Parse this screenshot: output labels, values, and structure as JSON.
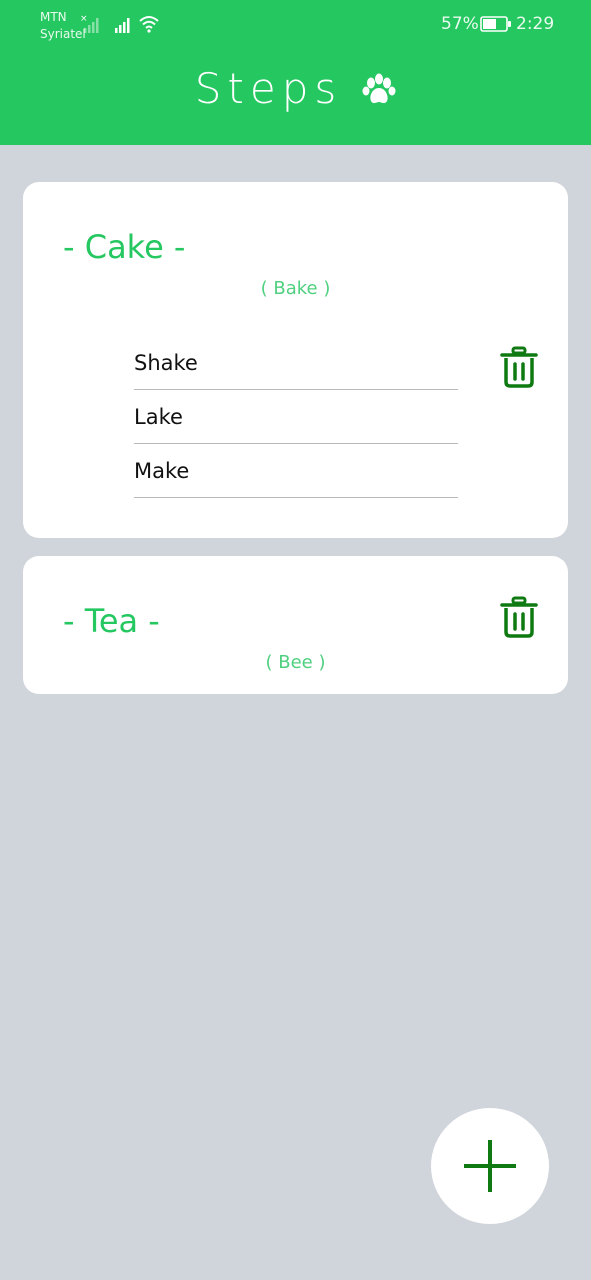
{
  "status_bar": {
    "carrier_line1": "MTN",
    "carrier_line2": "Syriatel",
    "battery_percent": "57%",
    "time": "2:29"
  },
  "header": {
    "title": "Steps",
    "icon": "paw-icon",
    "background": "#25c760"
  },
  "cards": [
    {
      "title": "- Cake -",
      "subtitle": "( Bake )",
      "steps": [
        "Shake",
        "Lake",
        "Make"
      ]
    },
    {
      "title": "- Tea -",
      "subtitle": "( Bee )",
      "steps": []
    }
  ],
  "fab": {
    "icon": "plus-icon"
  },
  "colors": {
    "accent": "#25c760",
    "icon_green": "#0f7a12",
    "page_background": "#d0d4db"
  }
}
